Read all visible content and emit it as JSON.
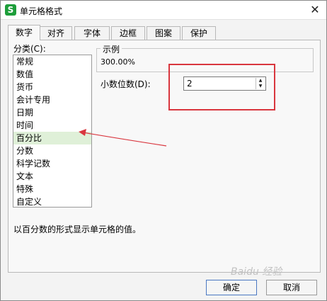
{
  "window": {
    "title": "单元格格式",
    "app_logo": "S",
    "close_glyph": "✕"
  },
  "tabs": [
    {
      "label": "数字",
      "active": true
    },
    {
      "label": "对齐",
      "active": false
    },
    {
      "label": "字体",
      "active": false
    },
    {
      "label": "边框",
      "active": false
    },
    {
      "label": "图案",
      "active": false
    },
    {
      "label": "保护",
      "active": false
    }
  ],
  "category": {
    "label": "分类(C):",
    "items": [
      "常规",
      "数值",
      "货币",
      "会计专用",
      "日期",
      "时间",
      "百分比",
      "分数",
      "科学记数",
      "文本",
      "特殊",
      "自定义"
    ],
    "selected": "百分比"
  },
  "sample": {
    "label": "示例",
    "value": "300.00%"
  },
  "decimal_places": {
    "label": "小数位数(D):",
    "value": "2"
  },
  "description": "以百分数的形式显示单元格的值。",
  "buttons": {
    "ok": "确定",
    "cancel": "取消"
  },
  "watermark": "Baidu 经验",
  "annotation_color": "#d9363e",
  "selection_color": "#dff0d8"
}
